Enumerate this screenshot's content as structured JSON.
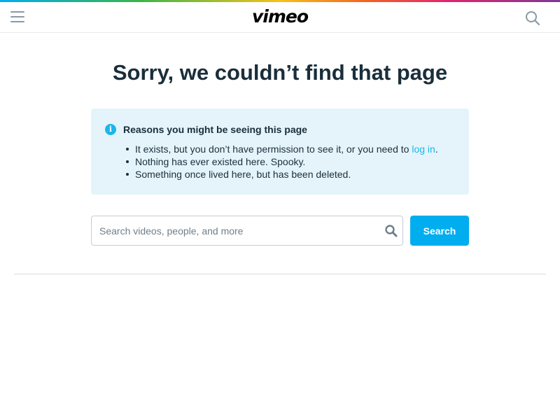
{
  "header": {
    "menu_icon": "hamburger-menu-icon",
    "logo_text": "vimeo",
    "search_icon": "search-icon"
  },
  "main": {
    "title": "Sorry, we couldn’t find that page",
    "info": {
      "icon": "info-icon",
      "icon_glyph": "i",
      "heading": "Reasons you might be seeing this page",
      "reasons": [
        {
          "text": "It exists, but you don’t have permission to see it, or you need to ",
          "link": "log in",
          "suffix": "."
        },
        {
          "text": "Nothing has ever existed here. Spooky."
        },
        {
          "text": "Something once lived here, but has been deleted."
        }
      ]
    },
    "search": {
      "placeholder": "Search videos, people, and more",
      "value": "",
      "button_label": "Search"
    }
  },
  "colors": {
    "brand": "#1ab7ea",
    "button": "#00adef",
    "info_bg": "#e5f4fb",
    "text": "#1a2e3b"
  }
}
